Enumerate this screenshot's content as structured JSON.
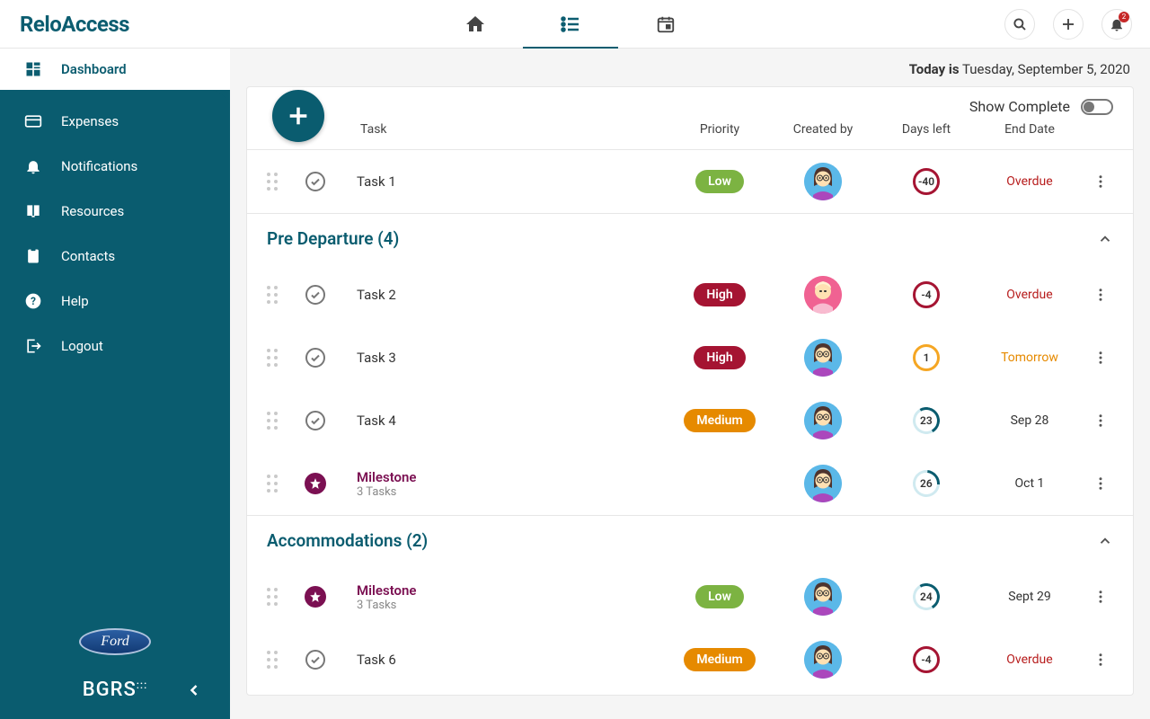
{
  "brand": "ReloAccess",
  "date_prefix": "Today is",
  "date_value": "Tuesday, September 5, 2020",
  "notifications_count": "2",
  "show_complete_label": "Show Complete",
  "columns": {
    "task": "Task",
    "priority": "Priority",
    "created": "Created by",
    "days": "Days left",
    "end": "End Date"
  },
  "sidebar": {
    "items": [
      {
        "label": "Dashboard",
        "icon": "dashboard"
      },
      {
        "label": "Expenses",
        "icon": "card"
      },
      {
        "label": "Notifications",
        "icon": "bell"
      },
      {
        "label": "Resources",
        "icon": "book"
      },
      {
        "label": "Contacts",
        "icon": "clipboard"
      },
      {
        "label": "Help",
        "icon": "help"
      },
      {
        "label": "Logout",
        "icon": "logout"
      }
    ]
  },
  "footer_brand": "Ford",
  "footer_brand2": "BGRS",
  "top_tasks": [
    {
      "name": "Task 1",
      "priority": "Low",
      "priority_class": "pill-low",
      "days": "-40",
      "ring": "ring-red",
      "end": "Overdue",
      "end_class": "end-overdue",
      "avatar": "brown"
    }
  ],
  "sections": [
    {
      "title": "Pre Departure (4)",
      "rows": [
        {
          "name": "Task 2",
          "priority": "High",
          "priority_class": "pill-high",
          "days": "-4",
          "ring": "ring-red",
          "end": "Overdue",
          "end_class": "end-overdue",
          "avatar": "blonde"
        },
        {
          "name": "Task 3",
          "priority": "High",
          "priority_class": "pill-high",
          "days": "1",
          "ring": "ring-orange",
          "end": "Tomorrow",
          "end_class": "end-tomorrow",
          "avatar": "brown"
        },
        {
          "name": "Task 4",
          "priority": "Medium",
          "priority_class": "pill-medium",
          "days": "23",
          "ring": "ring-teal-partial",
          "end": "Sep 28",
          "end_class": "",
          "avatar": "brown"
        },
        {
          "name": "Milestone",
          "sub": "3 Tasks",
          "milestone": true,
          "priority": "",
          "days": "26",
          "ring": "ring-teal-near",
          "end": "Oct 1",
          "end_class": "",
          "avatar": "brown"
        }
      ]
    },
    {
      "title": "Accommodations (2)",
      "rows": [
        {
          "name": "Milestone",
          "sub": "3 Tasks",
          "milestone": true,
          "priority": "Low",
          "priority_class": "pill-low",
          "days": "24",
          "ring": "ring-teal-partial",
          "end": "Sept 29",
          "end_class": "",
          "avatar": "brown"
        },
        {
          "name": "Task 6",
          "priority": "Medium",
          "priority_class": "pill-medium",
          "days": "-4",
          "ring": "ring-red",
          "end": "Overdue",
          "end_class": "end-overdue",
          "avatar": "brown"
        }
      ]
    }
  ]
}
